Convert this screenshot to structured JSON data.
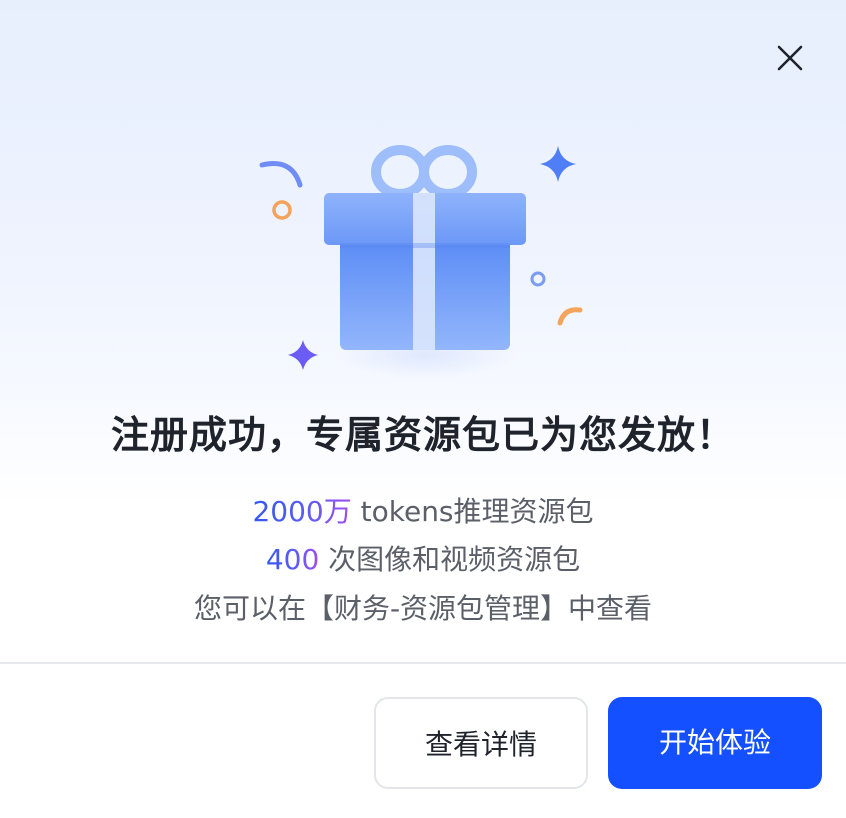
{
  "dialog": {
    "close_icon": "close-icon",
    "hero_icon": "gift-box-icon",
    "title": "注册成功，专属资源包已为您发放！",
    "benefits": [
      {
        "highlight": "2000万",
        "text": " tokens推理资源包"
      },
      {
        "highlight": "400",
        "text": " 次图像和视频资源包"
      }
    ],
    "note": "您可以在【财务-资源包管理】中查看",
    "buttons": {
      "secondary_label": "查看详情",
      "primary_label": "开始体验"
    },
    "colors": {
      "primary": "#1450FF",
      "title": "#1F232B",
      "body_text": "#5B5F68",
      "highlight_start": "#3358F0",
      "highlight_end": "#A14EF0",
      "gift": "#6F9BF8"
    }
  }
}
